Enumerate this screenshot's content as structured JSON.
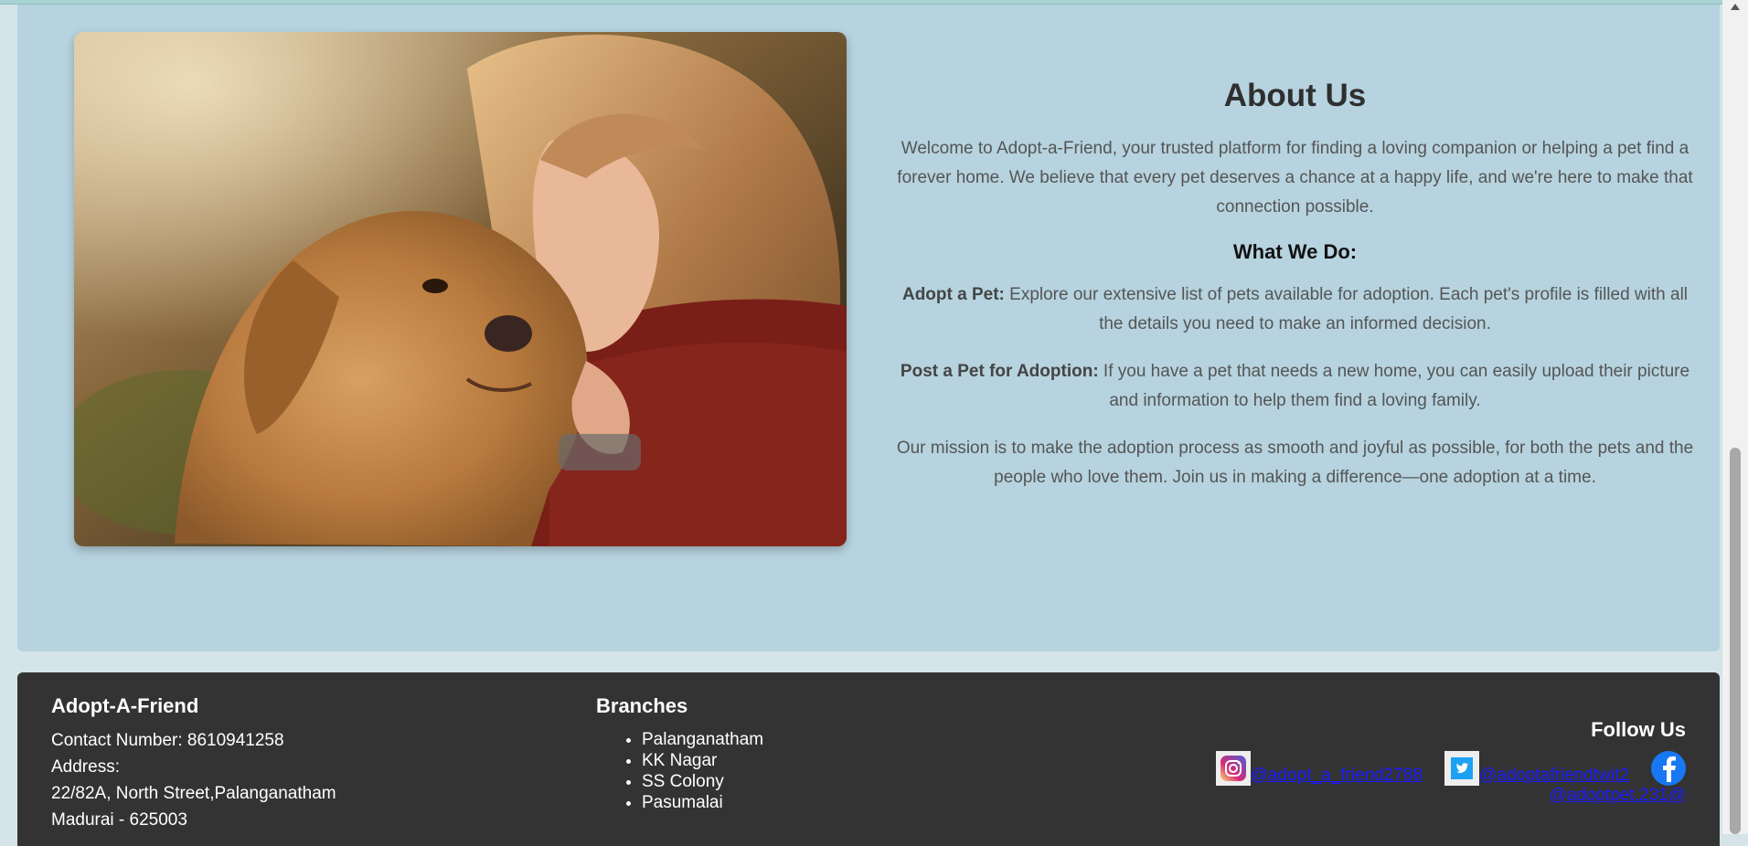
{
  "about": {
    "title": "About Us",
    "intro": "Welcome to Adopt-a-Friend, your trusted platform for finding a loving companion or helping a pet find a forever home. We believe that every pet deserves a chance at a happy life, and we're here to make that connection possible.",
    "what_title": "What We Do:",
    "adopt_label": "Adopt a Pet:",
    "adopt_text": " Explore our extensive list of pets available for adoption. Each pet's profile is filled with all the details you need to make an informed decision.",
    "post_label": "Post a Pet for Adoption:",
    "post_text": " If you have a pet that needs a new home, you can easily upload their picture and information to help them find a loving family.",
    "mission": "Our mission is to make the adoption process as smooth and joyful as possible, for both the pets and the people who love them. Join us in making a difference—one adoption at a time."
  },
  "footer": {
    "brand": "Adopt-A-Friend",
    "contact": "Contact Number: 8610941258",
    "address_label": "Address:",
    "address_line1": "22/82A, North Street,Palanganatham",
    "address_line2": "Madurai - 625003",
    "branches_title": "Branches",
    "branches": [
      "Palanganatham",
      "KK Nagar",
      "SS Colony",
      "Pasumalai"
    ],
    "follow_title": "Follow Us",
    "instagram": "@adopt_a_friend2788 ",
    "twitter": "@adoptafriendtwit2 ",
    "facebook": "@adoptpet.231@"
  },
  "colors": {
    "about_bg": "#b6d3df",
    "footer_bg": "#333333",
    "link": "#1a1aff",
    "facebook": "#1877f2"
  },
  "icons": [
    "instagram-icon",
    "twitter-icon",
    "facebook-icon"
  ]
}
